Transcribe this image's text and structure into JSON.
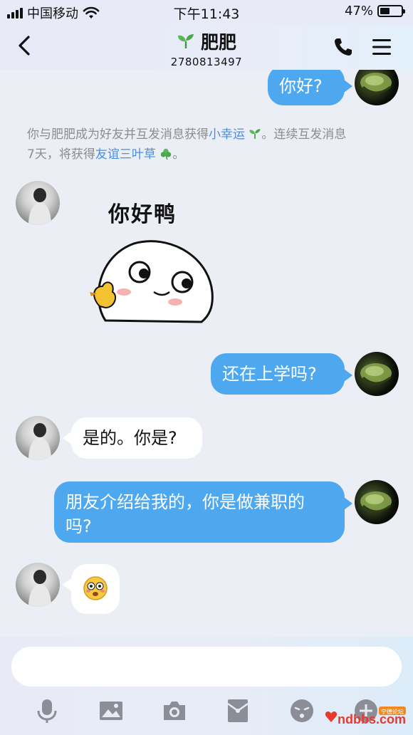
{
  "status_bar": {
    "carrier": "中国移动",
    "time": "下午11:43",
    "battery_percent": "47%",
    "battery_level": 0.47
  },
  "header": {
    "title": "肥肥",
    "subtitle": "2780813497"
  },
  "messages": [
    {
      "from": "me",
      "type": "text",
      "text": "你好?"
    },
    {
      "from": "system",
      "type": "notice",
      "parts": [
        "你与肥肥成为好友并互发消息获得",
        "小幸运",
        "。连续互发消息",
        "7天，将获得",
        "友谊三叶草",
        "。"
      ]
    },
    {
      "from": "other",
      "type": "sticker",
      "text": "你好鸭"
    },
    {
      "from": "me",
      "type": "text",
      "text": "还在上学吗?"
    },
    {
      "from": "other",
      "type": "text",
      "text": "是的。你是?"
    },
    {
      "from": "me",
      "type": "text",
      "lines": [
        "朋友介绍给我的，你是做兼职的",
        "吗?"
      ]
    },
    {
      "from": "other",
      "type": "emoji",
      "icon": "flushed-face-icon"
    }
  ],
  "input": {
    "value": "",
    "placeholder": ""
  },
  "toolbar": [
    "microphone-icon",
    "image-icon",
    "camera-icon",
    "red-packet-icon",
    "emoji-face-icon",
    "plus-icon"
  ],
  "watermark": {
    "text": "ndbbs.com",
    "badge": "宁德论坛"
  },
  "colors": {
    "bubble_me": "#4ea8f0",
    "bubble_other": "#ffffff",
    "chat_background": "#eceef6",
    "link": "#4b8ede"
  }
}
